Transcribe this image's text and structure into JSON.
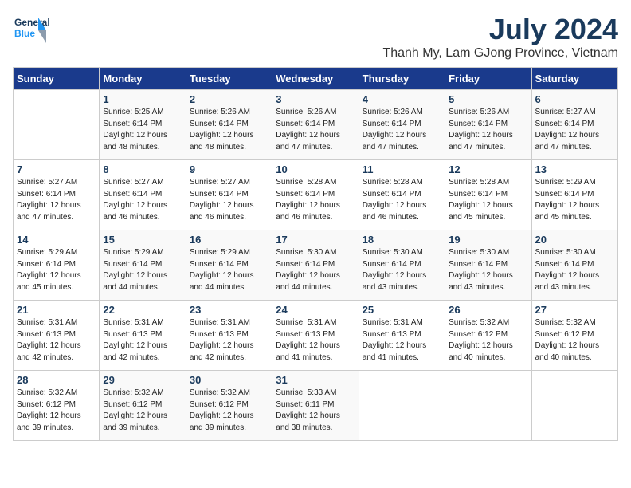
{
  "logo": {
    "text_general": "General",
    "text_blue": "Blue"
  },
  "title": {
    "month_year": "July 2024",
    "location": "Thanh My, Lam GJong Province, Vietnam"
  },
  "header_days": [
    "Sunday",
    "Monday",
    "Tuesday",
    "Wednesday",
    "Thursday",
    "Friday",
    "Saturday"
  ],
  "weeks": [
    [
      {
        "day": "",
        "info": ""
      },
      {
        "day": "1",
        "info": "Sunrise: 5:25 AM\nSunset: 6:14 PM\nDaylight: 12 hours\nand 48 minutes."
      },
      {
        "day": "2",
        "info": "Sunrise: 5:26 AM\nSunset: 6:14 PM\nDaylight: 12 hours\nand 48 minutes."
      },
      {
        "day": "3",
        "info": "Sunrise: 5:26 AM\nSunset: 6:14 PM\nDaylight: 12 hours\nand 47 minutes."
      },
      {
        "day": "4",
        "info": "Sunrise: 5:26 AM\nSunset: 6:14 PM\nDaylight: 12 hours\nand 47 minutes."
      },
      {
        "day": "5",
        "info": "Sunrise: 5:26 AM\nSunset: 6:14 PM\nDaylight: 12 hours\nand 47 minutes."
      },
      {
        "day": "6",
        "info": "Sunrise: 5:27 AM\nSunset: 6:14 PM\nDaylight: 12 hours\nand 47 minutes."
      }
    ],
    [
      {
        "day": "7",
        "info": "Sunrise: 5:27 AM\nSunset: 6:14 PM\nDaylight: 12 hours\nand 47 minutes."
      },
      {
        "day": "8",
        "info": "Sunrise: 5:27 AM\nSunset: 6:14 PM\nDaylight: 12 hours\nand 46 minutes."
      },
      {
        "day": "9",
        "info": "Sunrise: 5:27 AM\nSunset: 6:14 PM\nDaylight: 12 hours\nand 46 minutes."
      },
      {
        "day": "10",
        "info": "Sunrise: 5:28 AM\nSunset: 6:14 PM\nDaylight: 12 hours\nand 46 minutes."
      },
      {
        "day": "11",
        "info": "Sunrise: 5:28 AM\nSunset: 6:14 PM\nDaylight: 12 hours\nand 46 minutes."
      },
      {
        "day": "12",
        "info": "Sunrise: 5:28 AM\nSunset: 6:14 PM\nDaylight: 12 hours\nand 45 minutes."
      },
      {
        "day": "13",
        "info": "Sunrise: 5:29 AM\nSunset: 6:14 PM\nDaylight: 12 hours\nand 45 minutes."
      }
    ],
    [
      {
        "day": "14",
        "info": "Sunrise: 5:29 AM\nSunset: 6:14 PM\nDaylight: 12 hours\nand 45 minutes."
      },
      {
        "day": "15",
        "info": "Sunrise: 5:29 AM\nSunset: 6:14 PM\nDaylight: 12 hours\nand 44 minutes."
      },
      {
        "day": "16",
        "info": "Sunrise: 5:29 AM\nSunset: 6:14 PM\nDaylight: 12 hours\nand 44 minutes."
      },
      {
        "day": "17",
        "info": "Sunrise: 5:30 AM\nSunset: 6:14 PM\nDaylight: 12 hours\nand 44 minutes."
      },
      {
        "day": "18",
        "info": "Sunrise: 5:30 AM\nSunset: 6:14 PM\nDaylight: 12 hours\nand 43 minutes."
      },
      {
        "day": "19",
        "info": "Sunrise: 5:30 AM\nSunset: 6:14 PM\nDaylight: 12 hours\nand 43 minutes."
      },
      {
        "day": "20",
        "info": "Sunrise: 5:30 AM\nSunset: 6:14 PM\nDaylight: 12 hours\nand 43 minutes."
      }
    ],
    [
      {
        "day": "21",
        "info": "Sunrise: 5:31 AM\nSunset: 6:13 PM\nDaylight: 12 hours\nand 42 minutes."
      },
      {
        "day": "22",
        "info": "Sunrise: 5:31 AM\nSunset: 6:13 PM\nDaylight: 12 hours\nand 42 minutes."
      },
      {
        "day": "23",
        "info": "Sunrise: 5:31 AM\nSunset: 6:13 PM\nDaylight: 12 hours\nand 42 minutes."
      },
      {
        "day": "24",
        "info": "Sunrise: 5:31 AM\nSunset: 6:13 PM\nDaylight: 12 hours\nand 41 minutes."
      },
      {
        "day": "25",
        "info": "Sunrise: 5:31 AM\nSunset: 6:13 PM\nDaylight: 12 hours\nand 41 minutes."
      },
      {
        "day": "26",
        "info": "Sunrise: 5:32 AM\nSunset: 6:12 PM\nDaylight: 12 hours\nand 40 minutes."
      },
      {
        "day": "27",
        "info": "Sunrise: 5:32 AM\nSunset: 6:12 PM\nDaylight: 12 hours\nand 40 minutes."
      }
    ],
    [
      {
        "day": "28",
        "info": "Sunrise: 5:32 AM\nSunset: 6:12 PM\nDaylight: 12 hours\nand 39 minutes."
      },
      {
        "day": "29",
        "info": "Sunrise: 5:32 AM\nSunset: 6:12 PM\nDaylight: 12 hours\nand 39 minutes."
      },
      {
        "day": "30",
        "info": "Sunrise: 5:32 AM\nSunset: 6:12 PM\nDaylight: 12 hours\nand 39 minutes."
      },
      {
        "day": "31",
        "info": "Sunrise: 5:33 AM\nSunset: 6:11 PM\nDaylight: 12 hours\nand 38 minutes."
      },
      {
        "day": "",
        "info": ""
      },
      {
        "day": "",
        "info": ""
      },
      {
        "day": "",
        "info": ""
      }
    ]
  ]
}
